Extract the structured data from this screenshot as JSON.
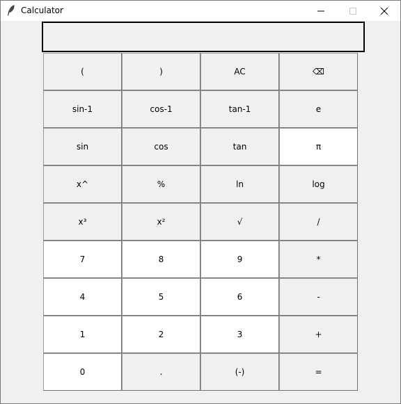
{
  "window": {
    "title": "Calculator",
    "icon": "feather-icon",
    "controls": [
      "minimize-icon",
      "maximize-icon",
      "close-icon"
    ]
  },
  "display": {
    "value": ""
  },
  "keypad": {
    "rows": [
      [
        {
          "label": "(",
          "style": "gray"
        },
        {
          "label": ")",
          "style": "gray"
        },
        {
          "label": "AC",
          "style": "gray"
        },
        {
          "label": "⌫",
          "style": "gray"
        }
      ],
      [
        {
          "label": "sin-1",
          "style": "gray"
        },
        {
          "label": "cos-1",
          "style": "gray"
        },
        {
          "label": "tan-1",
          "style": "gray"
        },
        {
          "label": "e",
          "style": "gray"
        }
      ],
      [
        {
          "label": "sin",
          "style": "gray"
        },
        {
          "label": "cos",
          "style": "gray"
        },
        {
          "label": "tan",
          "style": "gray"
        },
        {
          "label": "π",
          "style": "white"
        }
      ],
      [
        {
          "label": "x^",
          "style": "gray"
        },
        {
          "label": "%",
          "style": "gray"
        },
        {
          "label": "ln",
          "style": "gray"
        },
        {
          "label": "log",
          "style": "gray"
        }
      ],
      [
        {
          "label": "x³",
          "style": "gray"
        },
        {
          "label": "x²",
          "style": "gray"
        },
        {
          "label": "√",
          "style": "gray"
        },
        {
          "label": "/",
          "style": "gray"
        }
      ],
      [
        {
          "label": "7",
          "style": "white"
        },
        {
          "label": "8",
          "style": "white"
        },
        {
          "label": "9",
          "style": "white"
        },
        {
          "label": "*",
          "style": "gray"
        }
      ],
      [
        {
          "label": "4",
          "style": "white"
        },
        {
          "label": "5",
          "style": "white"
        },
        {
          "label": "6",
          "style": "white"
        },
        {
          "label": "-",
          "style": "gray"
        }
      ],
      [
        {
          "label": "1",
          "style": "white"
        },
        {
          "label": "2",
          "style": "white"
        },
        {
          "label": "3",
          "style": "white"
        },
        {
          "label": "+",
          "style": "gray"
        }
      ],
      [
        {
          "label": "0",
          "style": "white"
        },
        {
          "label": ".",
          "style": "gray"
        },
        {
          "label": "(-)",
          "style": "gray"
        },
        {
          "label": "=",
          "style": "gray"
        }
      ]
    ]
  },
  "colors": {
    "window_bg": "#f0f0f0",
    "key_gray": "#f0f0f0",
    "key_white": "#ffffff",
    "display_border": "#000000"
  }
}
